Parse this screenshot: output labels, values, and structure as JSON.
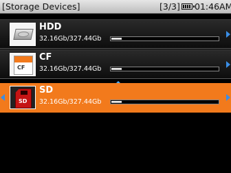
{
  "header": {
    "title": "[Storage Devices]",
    "count": "[3/3]",
    "time": "01:46AM"
  },
  "devices": [
    {
      "name": "HDD",
      "usage": "32.16Gb/327.44Gb",
      "used_fraction": 0.098,
      "icon": "hard-disk-icon",
      "selected": false
    },
    {
      "name": "CF",
      "usage": "32.16Gb/327.44Gb",
      "used_fraction": 0.098,
      "icon": "cf-card-icon",
      "icon_label": "CF",
      "selected": false
    },
    {
      "name": "SD",
      "usage": "32.16Gb/327.44Gb",
      "used_fraction": 0.098,
      "icon": "sd-card-icon",
      "icon_label": "SD",
      "selected": true
    }
  ],
  "colors": {
    "selection": "#f27a1c",
    "arrow": "#3a8ee6",
    "titlebar": "#d4d4d4"
  }
}
